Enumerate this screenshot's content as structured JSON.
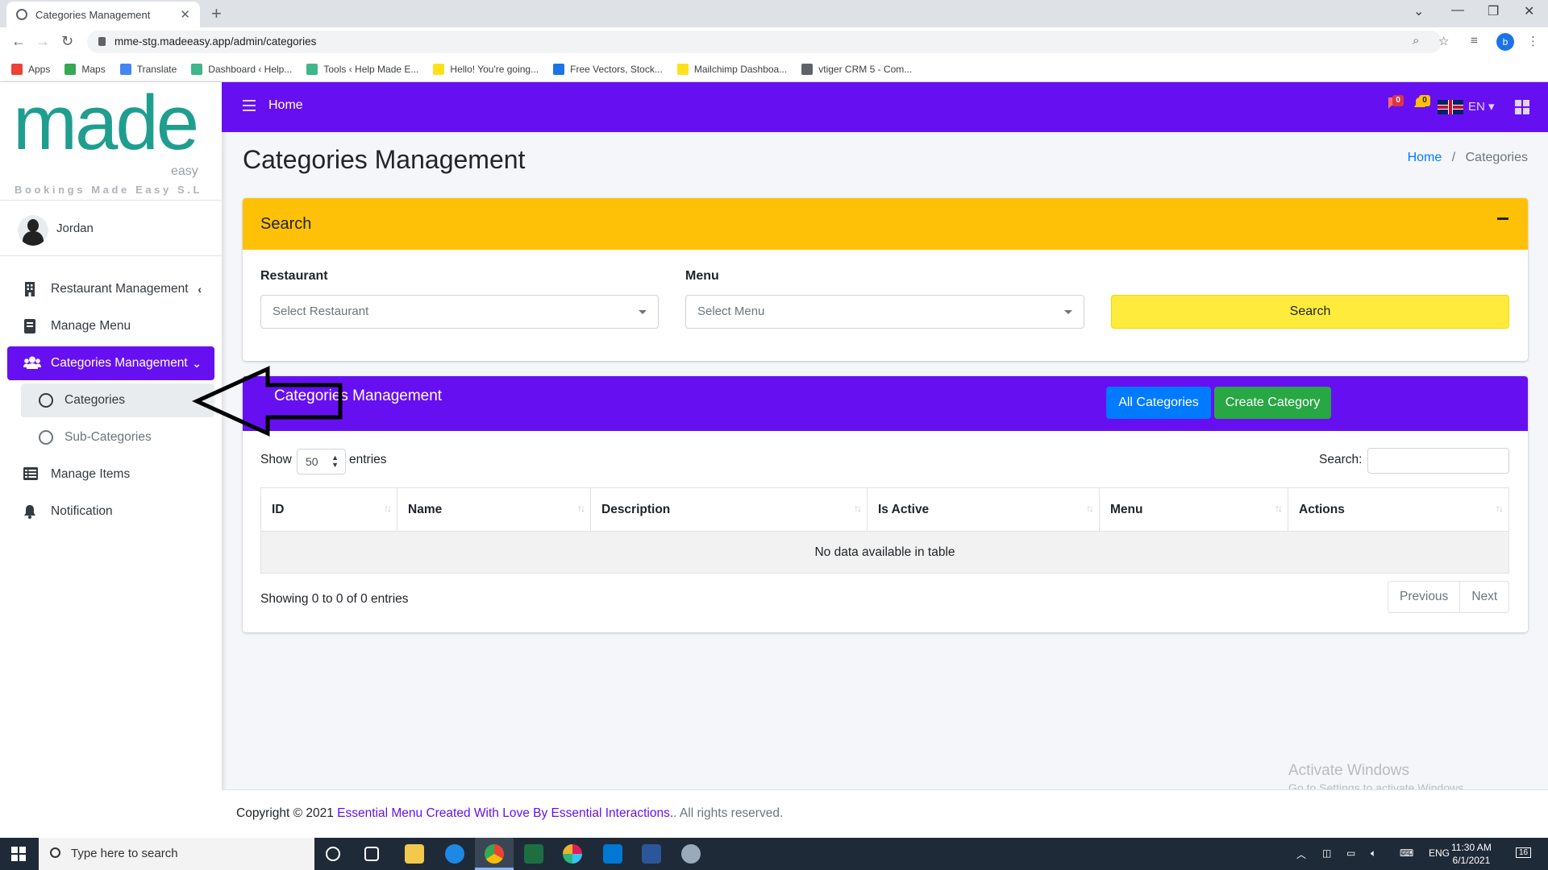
{
  "browser": {
    "tab_title": "Categories Management",
    "url": "mme-stg.madeeasy.app/admin/categories",
    "profile_initial": "b",
    "bookmarks": [
      {
        "label": "Apps",
        "icon": "apps-grid-icon",
        "color": "#ea4335"
      },
      {
        "label": "Maps",
        "icon": "maps-pin-icon",
        "color": "#34a853"
      },
      {
        "label": "Translate",
        "icon": "translate-icon",
        "color": "#4285f4"
      },
      {
        "label": "Dashboard ‹ Help...",
        "icon": "site-icon",
        "color": "#3fb68b"
      },
      {
        "label": "Tools ‹ Help Made E...",
        "icon": "site-icon",
        "color": "#3fb68b"
      },
      {
        "label": "Hello! You're going...",
        "icon": "mailchimp-icon",
        "color": "#ffe01b"
      },
      {
        "label": "Free Vectors, Stock...",
        "icon": "vecteezy-icon",
        "color": "#1a73e8"
      },
      {
        "label": "Mailchimp Dashboa...",
        "icon": "mailchimp-icon",
        "color": "#ffe01b"
      },
      {
        "label": "vtiger CRM 5 - Com...",
        "icon": "globe-icon",
        "color": "#5f6368"
      }
    ]
  },
  "sidebar": {
    "logo_word": "made",
    "logo_sub": "easy",
    "logo_tagline": "Bookings Made Easy S.L",
    "user_name": "Jordan",
    "items": [
      {
        "label": "Restaurant Management",
        "icon": "building-icon"
      },
      {
        "label": "Manage Menu",
        "icon": "book-icon"
      },
      {
        "label": "Categories Management",
        "icon": "users-icon"
      },
      {
        "label": "Categories",
        "icon": "circle-icon"
      },
      {
        "label": "Sub-Categories",
        "icon": "circle-icon"
      },
      {
        "label": "Manage Items",
        "icon": "list-icon"
      },
      {
        "label": "Notification",
        "icon": "bell-icon"
      }
    ]
  },
  "header": {
    "home_label": "Home",
    "messages_count": "0",
    "notifications_count": "0",
    "language": "EN"
  },
  "page": {
    "title": "Categories Management",
    "breadcrumb_home": "Home",
    "breadcrumb_current": "Categories"
  },
  "search_panel": {
    "title": "Search",
    "restaurant_label": "Restaurant",
    "restaurant_placeholder": "Select Restaurant",
    "menu_label": "Menu",
    "menu_placeholder": "Select Menu",
    "search_button": "Search"
  },
  "table_panel": {
    "title": "Categories Management",
    "all_button": "All Categories",
    "create_button": "Create Category",
    "show_label": "Show",
    "page_size": "50",
    "entries_label": "entries",
    "search_label": "Search:",
    "columns": [
      "ID",
      "Name",
      "Description",
      "Is Active",
      "Menu",
      "Actions"
    ],
    "empty_message": "No data available in table",
    "info": "Showing 0 to 0 of 0 entries",
    "previous": "Previous",
    "next": "Next"
  },
  "watermark": {
    "line1": "Activate Windows",
    "line2": "Go to Settings to activate Windows."
  },
  "footer": {
    "copyright": "Copyright © 2021",
    "link_text": "Essential Menu Created With Love By Essential Interactions.",
    "rights": ". All rights reserved."
  },
  "taskbar": {
    "search_placeholder": "Type here to search",
    "language": "ENG",
    "time": "11:30 AM",
    "date": "6/1/2021",
    "notification_count": "16"
  },
  "colors": {
    "primary_purple": "#6610f2",
    "warning_yellow": "#ffc107",
    "search_button_yellow": "#ffeb3b",
    "info_blue": "#007bff",
    "success_green": "#28a745",
    "logo_teal": "#1f9e8f"
  }
}
